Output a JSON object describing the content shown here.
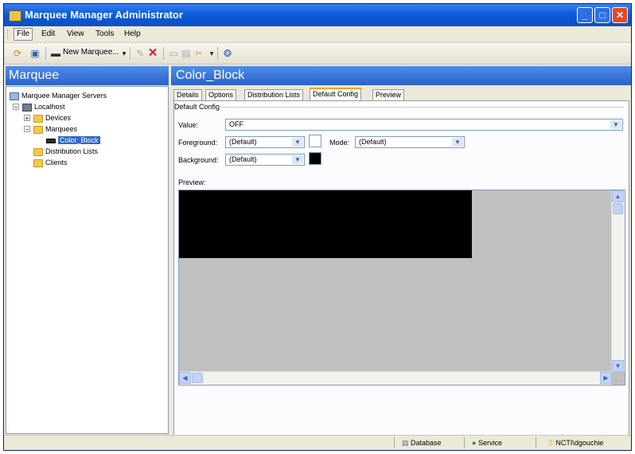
{
  "window": {
    "title": "Marquee Manager Administrator"
  },
  "menu": {
    "items": [
      "File",
      "Edit",
      "View",
      "Tools",
      "Help"
    ]
  },
  "toolbar": {
    "new_marquee_label": "New Marquee..."
  },
  "left_pane": {
    "header": "Marquee",
    "tree": {
      "root": "Marquee Manager Servers",
      "host": "Localhost",
      "devices": "Devices",
      "marquees": "Marquees",
      "selected": "Color_Block",
      "distribution_lists": "Distribution Lists",
      "clients": "Clients"
    }
  },
  "right_pane": {
    "header": "Color_Block",
    "tabs": [
      "Details",
      "Options",
      "Distribution Lists",
      "Default Config",
      "Preview"
    ],
    "active_tab": "Default Config",
    "group_title": "Default Config",
    "value_label": "Value:",
    "value": "OFF",
    "foreground_label": "Foreground:",
    "foreground": "(Default)",
    "mode_label": "Mode:",
    "mode": "(Default)",
    "background_label": "Background:",
    "background": "(Default)",
    "preview_label": "Preview:"
  },
  "colors": {
    "foreground_swatch": "#ffffff",
    "background_swatch": "#000000",
    "preview_block": "#000000",
    "preview_bg": "#c0c0c0"
  },
  "status": {
    "database": "Database",
    "service": "Service",
    "user": "NCTI\\dgouchie"
  }
}
